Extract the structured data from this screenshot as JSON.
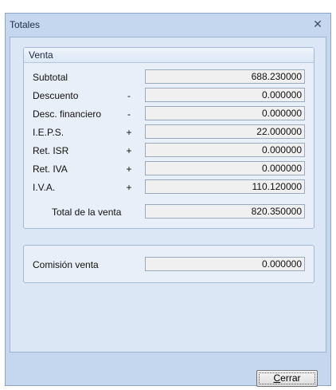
{
  "window": {
    "title": "Totales",
    "close_icon": "close-icon"
  },
  "venta": {
    "group_title": "Venta",
    "rows": [
      {
        "label": "Subtotal",
        "sign": "",
        "value": "688.230000"
      },
      {
        "label": "Descuento",
        "sign": "-",
        "value": "0.000000"
      },
      {
        "label": "Desc. financiero",
        "sign": "-",
        "value": "0.000000"
      },
      {
        "label": "I.E.P.S.",
        "sign": "+",
        "value": "22.000000"
      },
      {
        "label": "Ret. ISR",
        "sign": "+",
        "value": "0.000000"
      },
      {
        "label": "Ret. IVA",
        "sign": "+",
        "value": "0.000000"
      },
      {
        "label": "I.V.A.",
        "sign": "+",
        "value": "110.120000"
      }
    ],
    "total_label": "Total de la venta",
    "total_value": "820.350000"
  },
  "comision": {
    "label": "Comisión venta",
    "value": "0.000000"
  },
  "buttons": {
    "close_first": "C",
    "close_rest": "errar"
  },
  "colors": {
    "frame": "#c5d7ee",
    "panel": "#dbe7f5",
    "field": "#f0f0f0"
  }
}
